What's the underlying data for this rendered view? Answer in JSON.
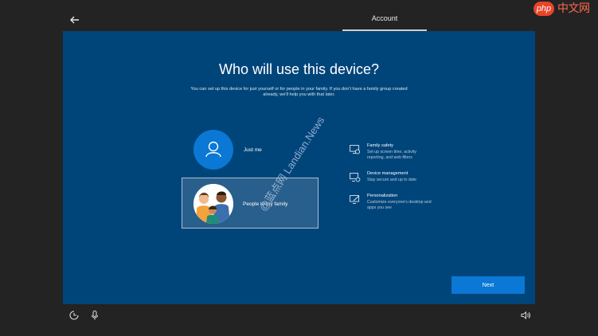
{
  "header": {
    "title": "Account",
    "back_icon": "back-arrow-icon"
  },
  "watermark_logo": {
    "php": "php",
    "cn": "中文网"
  },
  "main": {
    "heading": "Who will use this device?",
    "subtitle": "You can set up this device for just yourself or for people in your family. If you don't have a family group created already, we'll help you with that later.",
    "options": [
      {
        "label": "Just me",
        "icon": "person-icon",
        "selected": false
      },
      {
        "label": "People in my family",
        "icon": "family-illustration",
        "selected": true
      }
    ],
    "features": [
      {
        "title": "Family safety",
        "description": "Set up screen time, activity reporting, and web filters",
        "icon": "family-safety-icon"
      },
      {
        "title": "Device management",
        "description": "Stay secure and up to date",
        "icon": "device-management-icon"
      },
      {
        "title": "Personalization",
        "description": "Customize everyone's desktop and apps you see",
        "icon": "personalization-icon"
      }
    ],
    "next_label": "Next"
  },
  "overlay_watermark": "@蓝点网 Landian.News",
  "footer": {
    "icons": [
      "ease-of-access-icon",
      "microphone-icon",
      "volume-icon"
    ]
  },
  "colors": {
    "panel": "#00457a",
    "accent": "#0a78d4",
    "outer": "#232323"
  }
}
